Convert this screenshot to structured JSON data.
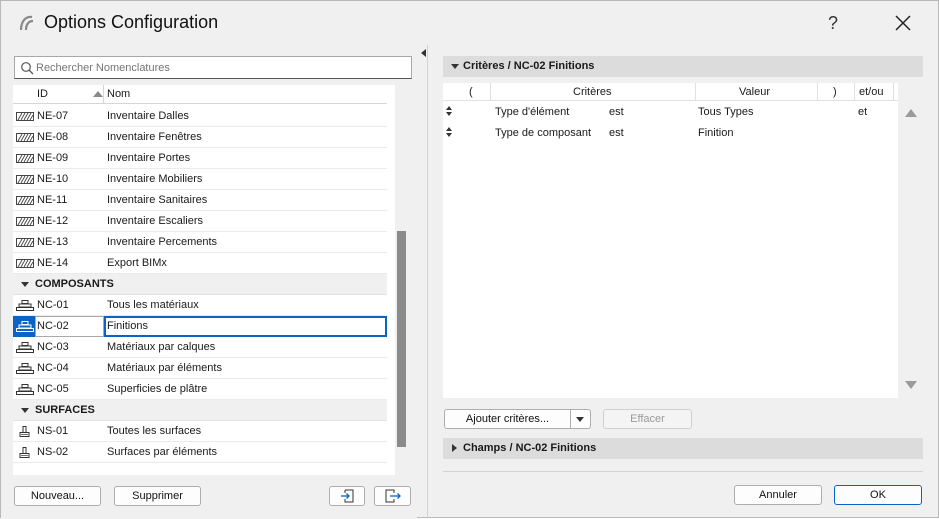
{
  "window": {
    "title": "Options Configuration",
    "help_label": "?"
  },
  "search": {
    "placeholder": "Rechercher Nomenclatures"
  },
  "list": {
    "header": {
      "id": "ID",
      "name": "Nom"
    },
    "rows": [
      {
        "kind": "item",
        "icon": "hatch-schedule-icon",
        "id": "NE-07",
        "name": "Inventaire Dalles"
      },
      {
        "kind": "item",
        "icon": "hatch-schedule-icon",
        "id": "NE-08",
        "name": "Inventaire Fenêtres"
      },
      {
        "kind": "item",
        "icon": "hatch-schedule-icon",
        "id": "NE-09",
        "name": "Inventaire Portes"
      },
      {
        "kind": "item",
        "icon": "hatch-schedule-icon",
        "id": "NE-10",
        "name": "Inventaire Mobiliers"
      },
      {
        "kind": "item",
        "icon": "hatch-schedule-icon",
        "id": "NE-11",
        "name": "Inventaire Sanitaires"
      },
      {
        "kind": "item",
        "icon": "hatch-schedule-icon",
        "id": "NE-12",
        "name": "Inventaire Escaliers"
      },
      {
        "kind": "item",
        "icon": "hatch-schedule-icon",
        "id": "NE-13",
        "name": "Inventaire Percements"
      },
      {
        "kind": "item",
        "icon": "hatch-schedule-icon",
        "id": "NE-14",
        "name": "Export BIMx"
      },
      {
        "kind": "group",
        "name": "COMPOSANTS"
      },
      {
        "kind": "item",
        "icon": "components-icon",
        "id": "NC-01",
        "name": "Tous les matériaux"
      },
      {
        "kind": "item",
        "icon": "components-icon",
        "id": "NC-02",
        "name": "Finitions",
        "selected": true
      },
      {
        "kind": "item",
        "icon": "components-icon",
        "id": "NC-03",
        "name": "Matériaux par calques"
      },
      {
        "kind": "item",
        "icon": "components-icon",
        "id": "NC-04",
        "name": "Matériaux par éléments"
      },
      {
        "kind": "item",
        "icon": "components-icon",
        "id": "NC-05",
        "name": "Superficies de plâtre"
      },
      {
        "kind": "group",
        "name": "SURFACES"
      },
      {
        "kind": "item",
        "icon": "surface-brush-icon",
        "id": "NS-01",
        "name": "Toutes les surfaces"
      },
      {
        "kind": "item",
        "icon": "surface-brush-icon",
        "id": "NS-02",
        "name": "Surfaces par éléments"
      }
    ]
  },
  "left_buttons": {
    "new": "Nouveau...",
    "delete": "Supprimer"
  },
  "criteria": {
    "section_title": "Critères / NC-02 Finitions",
    "headers": {
      "open_paren": "(",
      "criteria": "Critères",
      "value": "Valeur",
      "close_paren": ")",
      "and_or": "et/ou"
    },
    "rows": [
      {
        "criterion": "Type d'élément",
        "operator": "est",
        "value": "Tous Types",
        "and_or": "et"
      },
      {
        "criterion": "Type de composant",
        "operator": "est",
        "value": "Finition",
        "and_or": ""
      }
    ],
    "add_button": "Ajouter critères...",
    "clear_button": "Effacer"
  },
  "fields": {
    "section_title": "Champs / NC-02 Finitions"
  },
  "footer": {
    "cancel": "Annuler",
    "ok": "OK"
  },
  "colors": {
    "accent": "#0a64c8",
    "section_bar": "#dcdcdc",
    "window_bg": "#f0f0f0"
  }
}
